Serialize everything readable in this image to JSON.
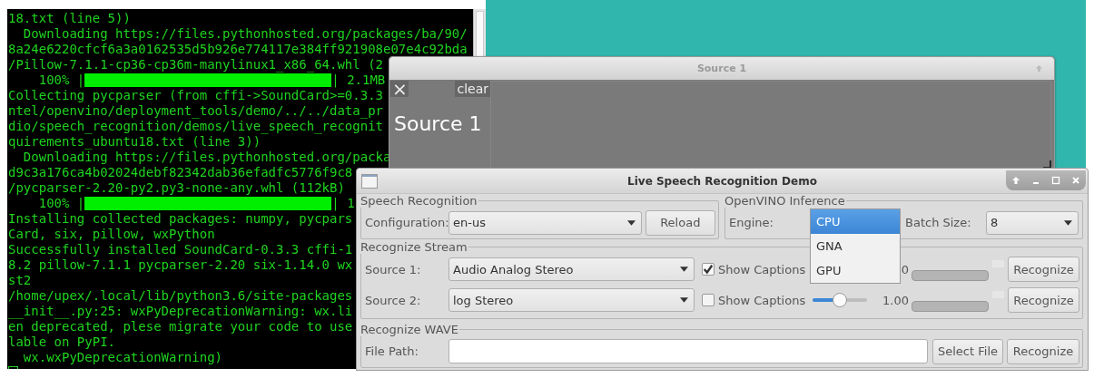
{
  "terminal": {
    "lines": [
      {
        "kind": "text",
        "text": "18.txt (line 5))"
      },
      {
        "kind": "text",
        "text": "  Downloading https://files.pythonhosted.org/packages/ba/90/"
      },
      {
        "kind": "text",
        "text": "8a24e6220cfcf6a3a0162535d5b926e774117e384ff921908e07e4c92bda"
      },
      {
        "kind": "text",
        "text": "/Pillow-7.1.1-cp36-cp36m-manylinux1_x86_64.whl (2"
      },
      {
        "kind": "progress",
        "prefix": "    100% |",
        "suffix": "| 2.1MB"
      },
      {
        "kind": "text",
        "text": "Collecting pycparser (from cffi->SoundCard>=0.3.3"
      },
      {
        "kind": "text",
        "text": "ntel/openvino/deployment_tools/demo/../../data_pr"
      },
      {
        "kind": "text",
        "text": "dio/speech_recognition/demos/live_speech_recognit"
      },
      {
        "kind": "text",
        "text": "quirements_ubuntu18.txt (line 3))"
      },
      {
        "kind": "text",
        "text": "  Downloading https://files.pythonhosted.org/packa"
      },
      {
        "kind": "text",
        "text": "d9c3a176ca4b02024debf82342dab36efadfc5776f9c8"
      },
      {
        "kind": "text",
        "text": "/pycparser-2.20-py2.py3-none-any.whl (112kB)"
      },
      {
        "kind": "progress",
        "prefix": "    100% |",
        "suffix": "| 1"
      },
      {
        "kind": "text",
        "text": "Installing collected packages: numpy, pycpars"
      },
      {
        "kind": "text",
        "text": "Card, six, pillow, wxPython"
      },
      {
        "kind": "text",
        "text": "Successfully installed SoundCard-0.3.3 cffi-1"
      },
      {
        "kind": "text",
        "text": "8.2 pillow-7.1.1 pycparser-2.20 six-1.14.0 wx"
      },
      {
        "kind": "text",
        "text": "st2"
      },
      {
        "kind": "text",
        "text": "/home/upex/.local/lib/python3.6/site-packages"
      },
      {
        "kind": "text",
        "text": "__init__.py:25: wxPyDeprecationWarning: wx.li"
      },
      {
        "kind": "text",
        "text": "en deprecated, plese migrate your code to use"
      },
      {
        "kind": "text",
        "text": "lable on PyPI."
      },
      {
        "kind": "text",
        "text": "  wx.wxPyDeprecationWarning)"
      }
    ]
  },
  "source_window": {
    "title": "Source 1",
    "close": "×",
    "clear": "clear",
    "caption": "Source 1"
  },
  "demo_window": {
    "title": "Live Speech Recognition Demo",
    "speech_group": {
      "legend": "Speech Recognition",
      "label": "Configuration:",
      "value": "en-us",
      "button": "Reload"
    },
    "inference_group": {
      "legend": "OpenVINO Inference",
      "engine_label": "Engine:",
      "engine_options": [
        {
          "label": "CPU",
          "selected": true
        },
        {
          "label": "GNA",
          "selected": false
        },
        {
          "label": "GPU",
          "selected": false
        }
      ],
      "batch_label": "Batch Size:",
      "batch_value": "8"
    },
    "stream_group": {
      "legend": "Recognize Stream",
      "sources": [
        {
          "label": "Source 1:",
          "device": "Audio Analog Stereo",
          "captions_checked": true,
          "captions_label": "Show Captions",
          "gain": "0",
          "button": "Recognize"
        },
        {
          "label": "Source 2:",
          "device": "log Stereo",
          "captions_checked": false,
          "captions_label": "Show Captions",
          "slider": {
            "level": 0.5
          },
          "gain": "1.00",
          "button": "Recognize"
        }
      ]
    },
    "wave_group": {
      "legend": "Recognize WAVE",
      "label": "File Path:",
      "select_button": "Select File",
      "button": "Recognize"
    }
  }
}
